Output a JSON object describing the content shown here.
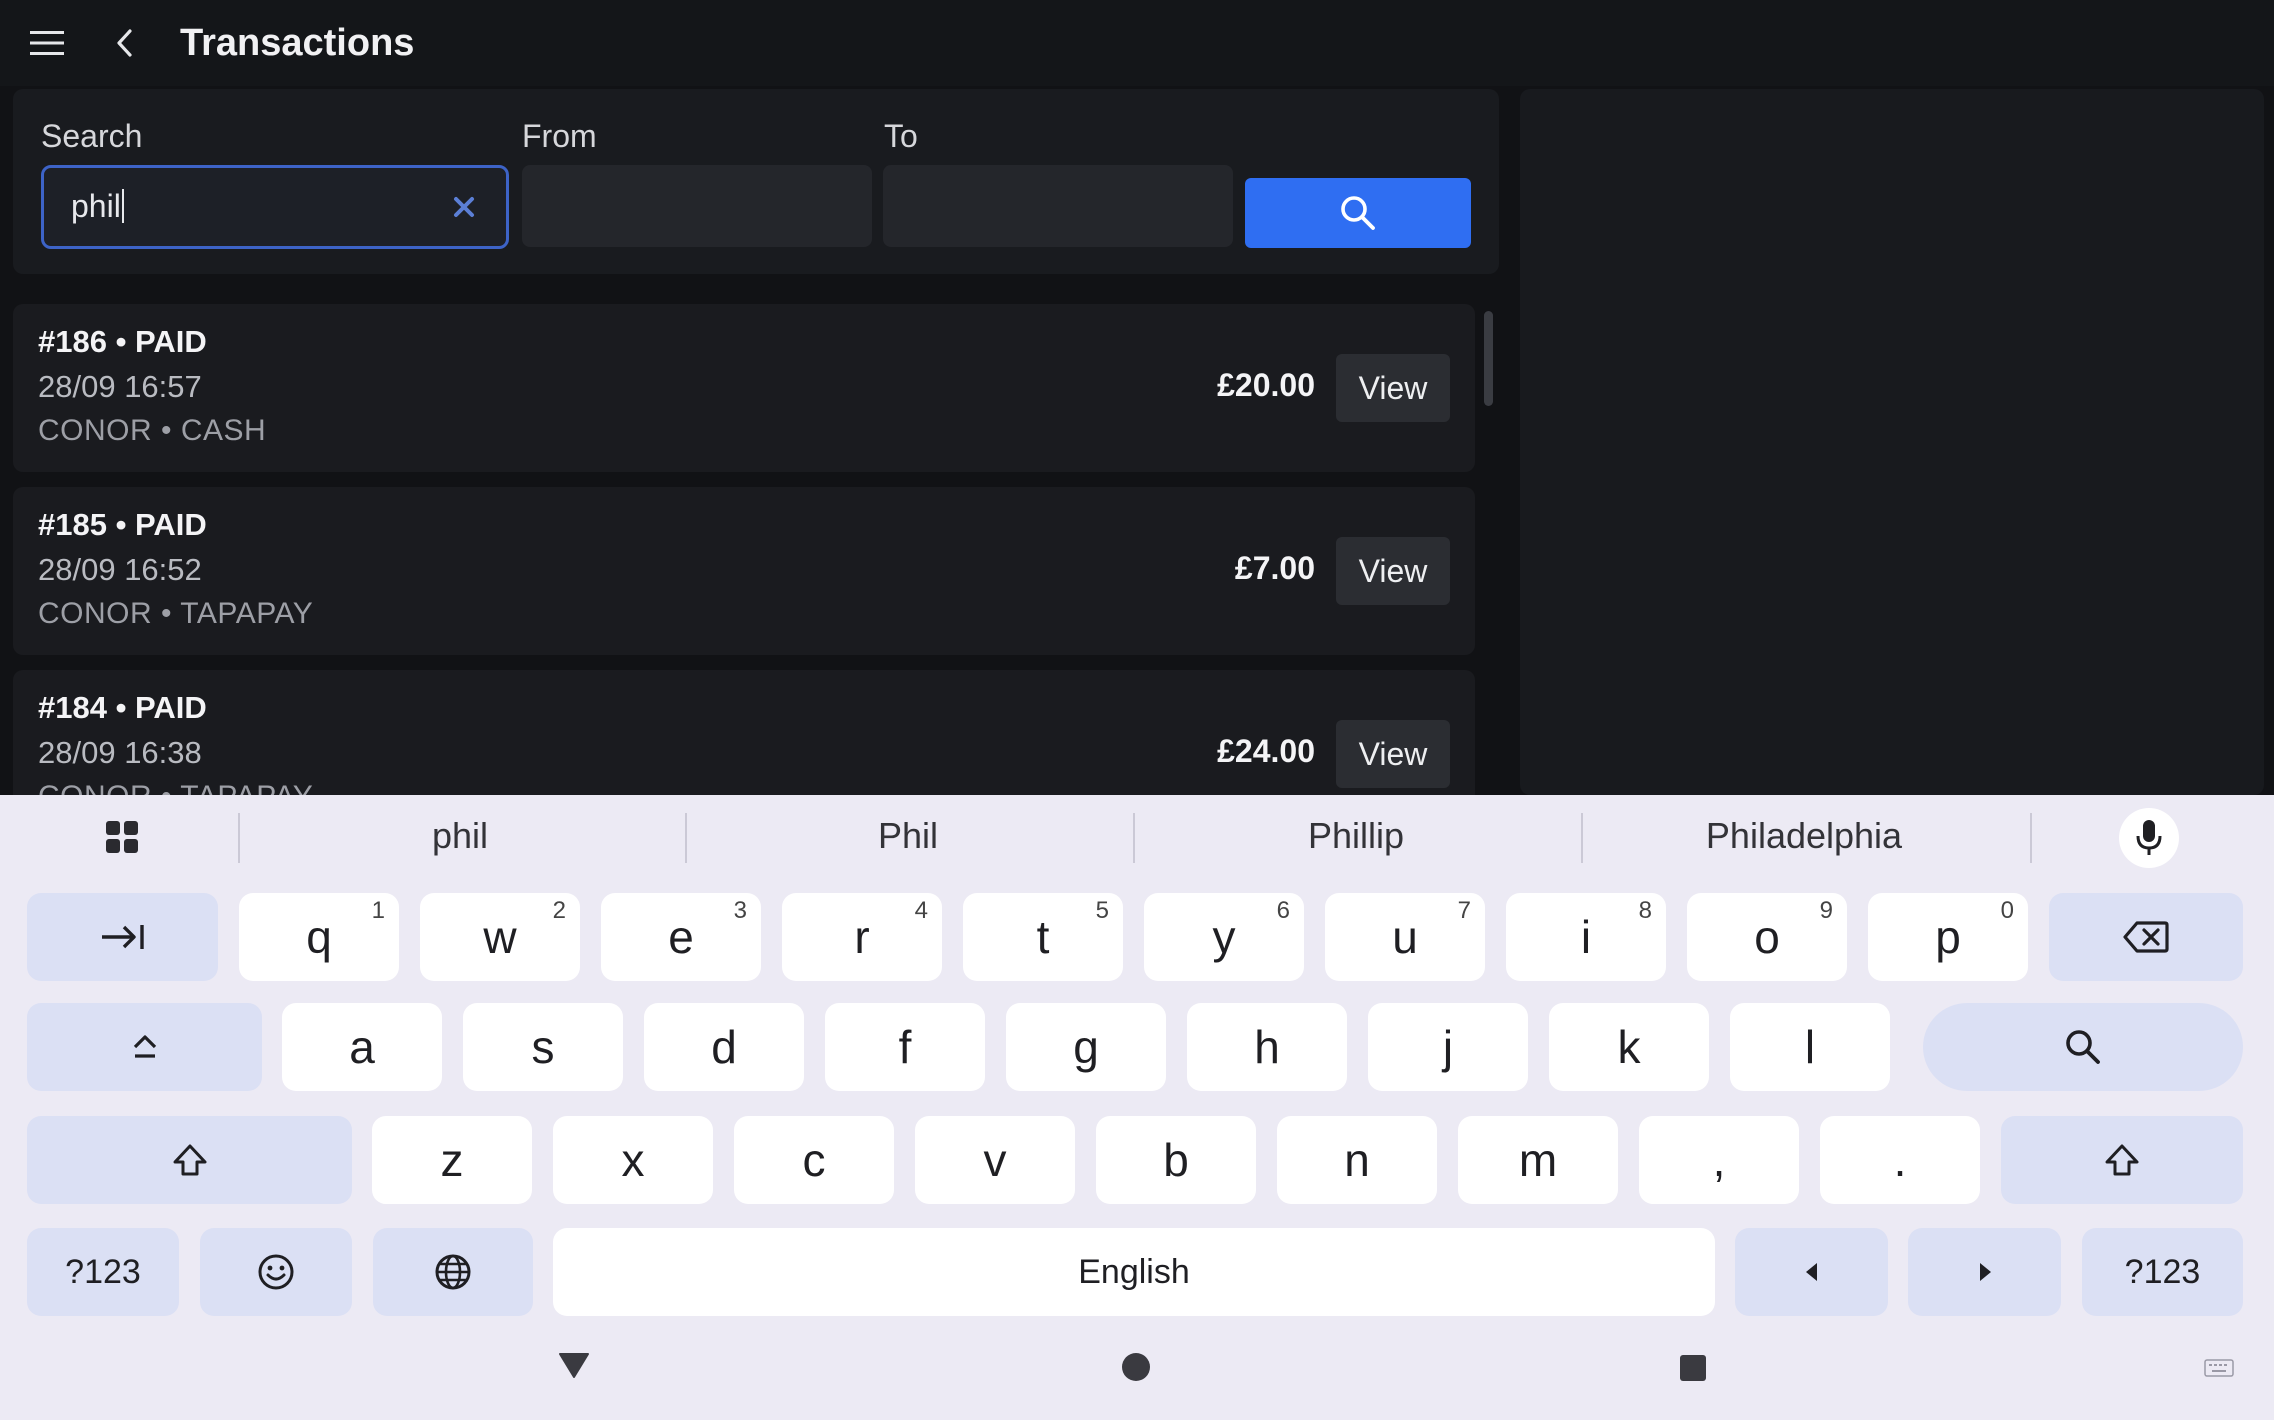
{
  "app_bar": {
    "title": "Transactions"
  },
  "filters": {
    "search_label": "Search",
    "search_value": "phil",
    "from_label": "From",
    "from_value": "",
    "to_label": "To",
    "to_value": ""
  },
  "transactions": [
    {
      "title": "#186 • PAID",
      "datetime": "28/09 16:57",
      "meta": "CONOR • CASH",
      "amount": "£20.00",
      "action": "View"
    },
    {
      "title": "#185 • PAID",
      "datetime": "28/09 16:52",
      "meta": "CONOR • TAPAPAY",
      "amount": "£7.00",
      "action": "View"
    },
    {
      "title": "#184 • PAID",
      "datetime": "28/09 16:38",
      "meta": "CONOR • TAPAPAY",
      "amount": "£24.00",
      "action": "View"
    }
  ],
  "keyboard": {
    "suggestions": [
      "phil",
      "Phil",
      "Phillip",
      "Philadelphia"
    ],
    "row1": [
      {
        "key": "q",
        "hint": "1"
      },
      {
        "key": "w",
        "hint": "2"
      },
      {
        "key": "e",
        "hint": "3"
      },
      {
        "key": "r",
        "hint": "4"
      },
      {
        "key": "t",
        "hint": "5"
      },
      {
        "key": "y",
        "hint": "6"
      },
      {
        "key": "u",
        "hint": "7"
      },
      {
        "key": "i",
        "hint": "8"
      },
      {
        "key": "o",
        "hint": "9"
      },
      {
        "key": "p",
        "hint": "0"
      }
    ],
    "row2": [
      "a",
      "s",
      "d",
      "f",
      "g",
      "h",
      "j",
      "k",
      "l"
    ],
    "row3": [
      "z",
      "x",
      "c",
      "v",
      "b",
      "n",
      "m",
      ",",
      "."
    ],
    "symbols_label": "?123",
    "space_label": "English"
  },
  "colors": {
    "accent": "#2f6ef2",
    "background": "#111215",
    "keyboard_bg": "#eceaf4",
    "function_key": "#dbe0f4"
  },
  "icons": {
    "menu": "menu-icon",
    "back": "chevron-left-icon",
    "clear": "close-icon",
    "search": "search-icon",
    "apps": "grid-icon",
    "mic": "microphone-icon"
  }
}
